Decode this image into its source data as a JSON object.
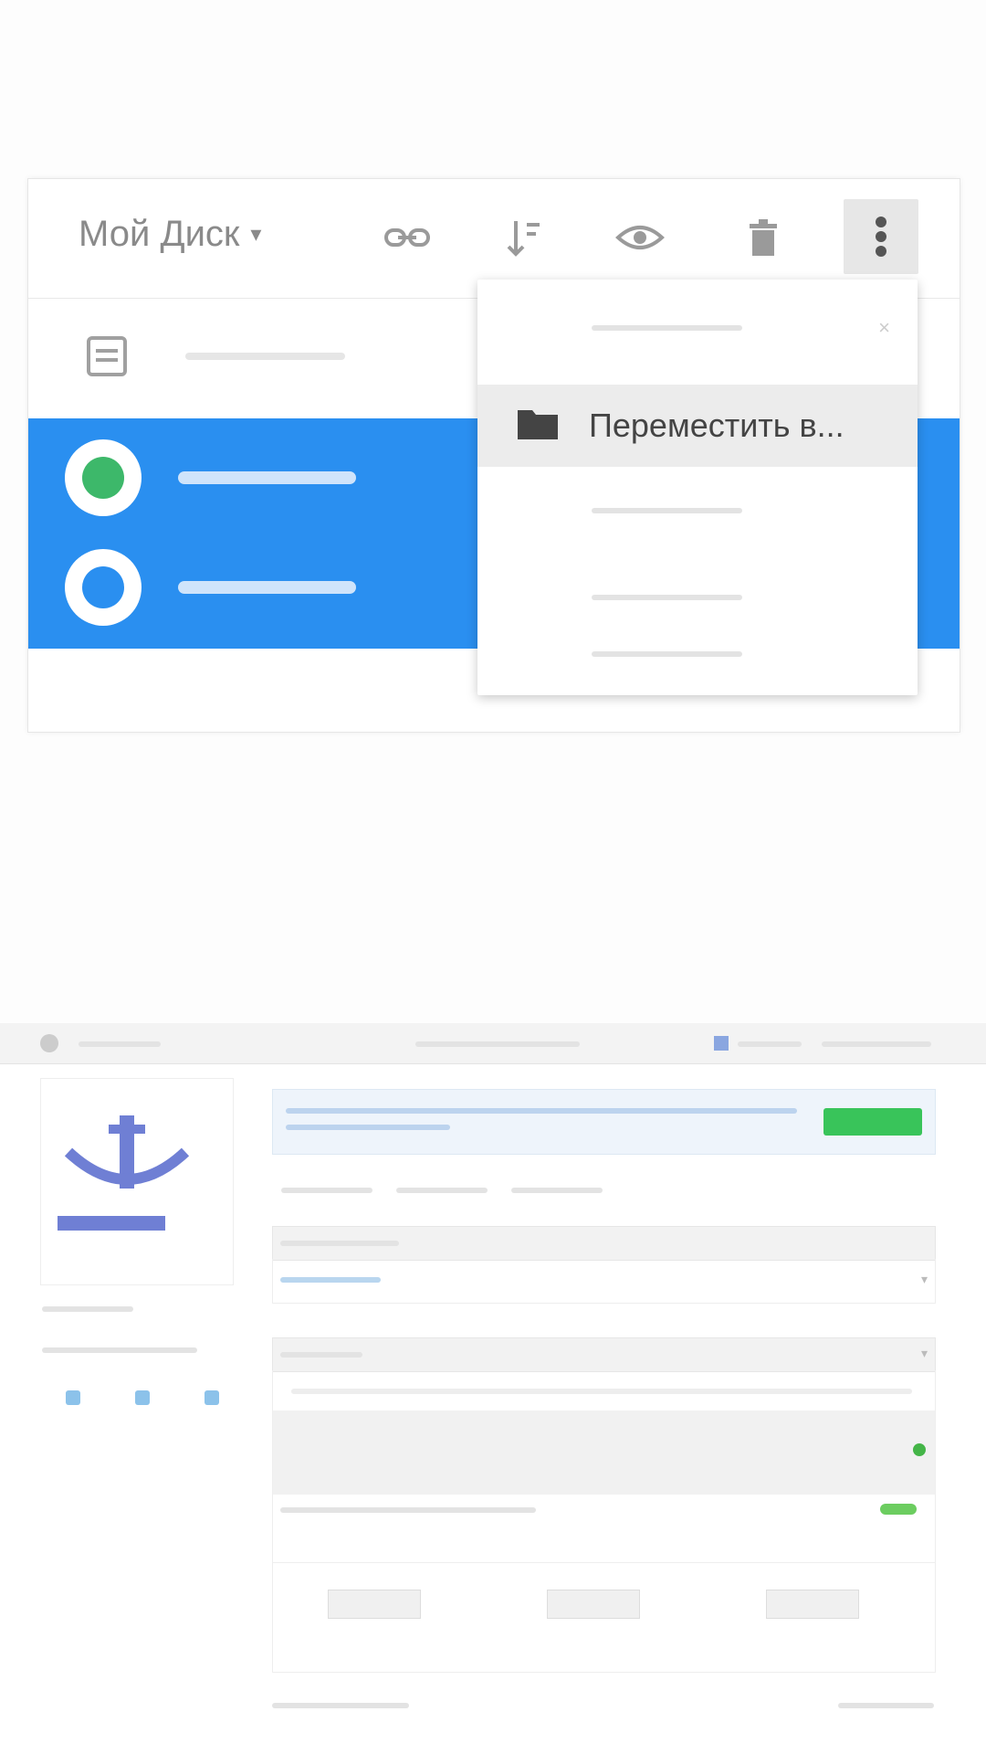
{
  "drive": {
    "title": "Мой Диск",
    "menu": {
      "highlighted_label": "Переместить в..."
    }
  },
  "colors": {
    "selection": "#2a8ff0",
    "avatar_green": "#3db86a",
    "avatar_blue": "#2a8ff0",
    "action_green": "#39c45a"
  },
  "icons": {
    "title_dropdown": "chevron-down-icon",
    "link": "link-icon",
    "sort": "sort-icon",
    "preview": "eye-icon",
    "delete": "trash-icon",
    "more": "more-vert-icon",
    "folder": "folder-icon",
    "file": "file-icon"
  }
}
